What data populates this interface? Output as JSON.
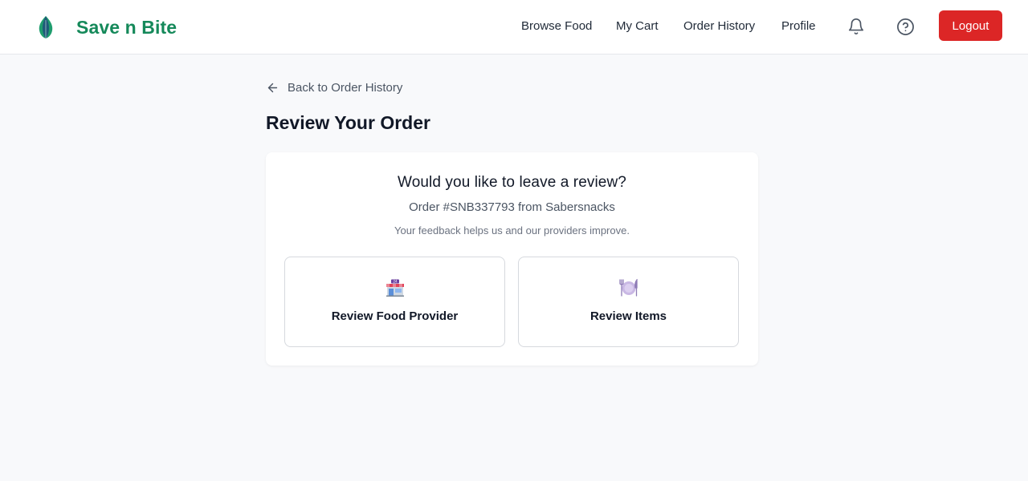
{
  "header": {
    "brand_name": "Save n Bite",
    "nav": {
      "browse_food": "Browse Food",
      "my_cart": "My Cart",
      "order_history": "Order History",
      "profile": "Profile"
    },
    "icons": {
      "logo": "leaf-icon",
      "notifications": "bell-icon",
      "help": "question-circle-icon"
    },
    "logout_label": "Logout"
  },
  "main": {
    "back_link": "Back to Order History",
    "page_title": "Review Your Order",
    "card": {
      "heading": "Would you like to leave a review?",
      "order_line": "Order #SNB337793 from Sabersnacks",
      "note": "Your feedback helps us and our providers improve.",
      "options": [
        {
          "label": "Review Food Provider",
          "icon": "convenience-store-icon"
        },
        {
          "label": "Review Items",
          "icon": "plate-with-cutlery-icon"
        }
      ]
    }
  },
  "colors": {
    "brand_green": "#15895a",
    "logout_red": "#dc2626",
    "page_background": "#f8f9fb",
    "card_background": "#ffffff"
  }
}
